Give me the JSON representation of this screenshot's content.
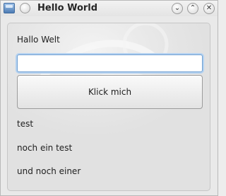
{
  "window": {
    "title": "Hello World",
    "titlebar_buttons": {
      "minimize_glyph": "⌄",
      "maximize_glyph": "⌃",
      "close_glyph": "✕"
    }
  },
  "form": {
    "heading_label": "Hallo Welt",
    "text_input": {
      "value": "",
      "placeholder": ""
    },
    "button_label": "Klick mich",
    "labels": [
      "test",
      "noch ein test",
      "und noch einer"
    ]
  },
  "colors": {
    "focus_ring": "#6f9fd1",
    "window_background": "#e9e9e9"
  }
}
